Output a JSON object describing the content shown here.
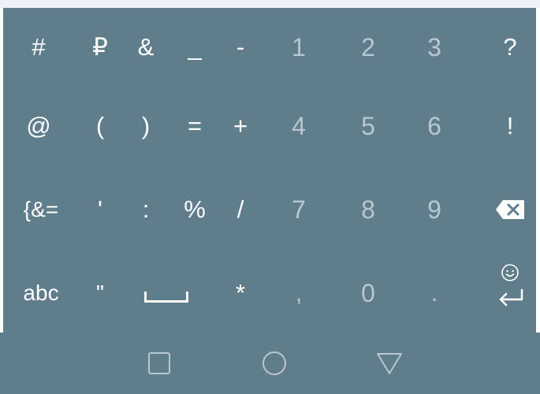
{
  "keyboard": {
    "row1": [
      "#",
      "₽",
      "&",
      "_",
      "-",
      "1",
      "2",
      "3",
      "?"
    ],
    "row2": [
      "@",
      "(",
      ")",
      "=",
      "+",
      "4",
      "5",
      "6",
      "!"
    ],
    "row3": [
      "{&=",
      "'",
      ":",
      "%",
      "/",
      "7",
      "8",
      "9"
    ],
    "row4": [
      "abc",
      "\"",
      "*",
      ",",
      "0",
      "."
    ]
  },
  "icons": {
    "backspace": "backspace-icon",
    "space": "space-bar-icon",
    "emoji": "emoji-icon",
    "enter": "enter-icon",
    "recents": "square-recents-icon",
    "home": "circle-home-icon",
    "back": "triangle-back-icon"
  },
  "colors": {
    "keyboard_bg": "#607d8b",
    "key_text": "#ffffff",
    "digit_text": "#b9c8d0"
  }
}
